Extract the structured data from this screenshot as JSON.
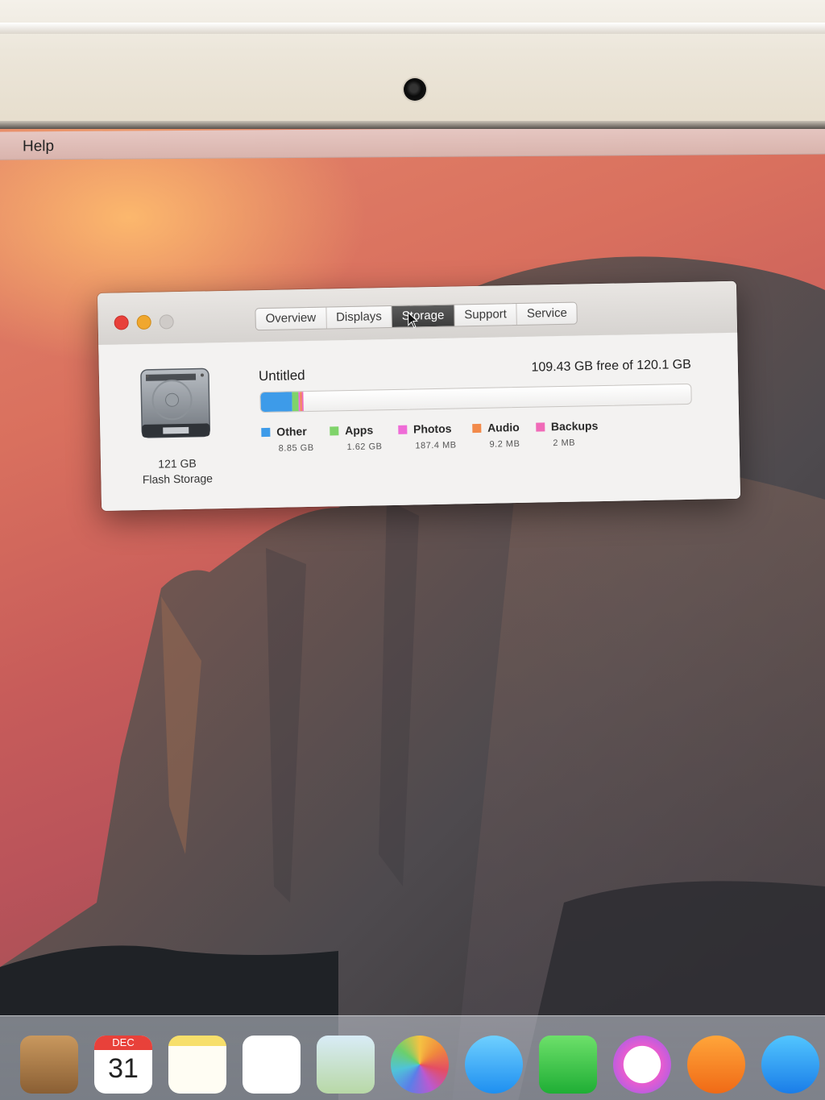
{
  "menubar": {
    "help_label": "Help"
  },
  "window": {
    "tabs": [
      {
        "label": "Overview",
        "active": false
      },
      {
        "label": "Displays",
        "active": false
      },
      {
        "label": "Storage",
        "active": true
      },
      {
        "label": "Support",
        "active": false
      },
      {
        "label": "Service",
        "active": false
      }
    ],
    "drive": {
      "capacity": "121 GB",
      "type": "Flash Storage",
      "icon": "hard-drive-icon"
    },
    "volume": {
      "name": "Untitled",
      "free_text": "109.43 GB free of 120.1 GB",
      "free_gb": 109.43,
      "total_gb": 120.1
    },
    "legend": [
      {
        "name": "Other",
        "size": "8.85 GB",
        "gb": 8.85,
        "color": "#3d9be9"
      },
      {
        "name": "Apps",
        "size": "1.62 GB",
        "gb": 1.62,
        "color": "#7fd36a"
      },
      {
        "name": "Photos",
        "size": "187.4 MB",
        "gb": 0.1874,
        "color": "#ef6bd7"
      },
      {
        "name": "Audio",
        "size": "9.2 MB",
        "gb": 0.0092,
        "color": "#f28a4a"
      },
      {
        "name": "Backups",
        "size": "2 MB",
        "gb": 0.002,
        "color": "#f06ab8"
      }
    ]
  },
  "dock": {
    "items": [
      {
        "name": "contacts-icon"
      },
      {
        "name": "calendar-icon",
        "month": "DEC",
        "day": "31"
      },
      {
        "name": "notes-icon"
      },
      {
        "name": "reminders-icon"
      },
      {
        "name": "maps-icon"
      },
      {
        "name": "photos-icon"
      },
      {
        "name": "messages-icon"
      },
      {
        "name": "facetime-icon"
      },
      {
        "name": "itunes-icon"
      },
      {
        "name": "ibooks-icon"
      },
      {
        "name": "app-store-icon"
      }
    ]
  }
}
